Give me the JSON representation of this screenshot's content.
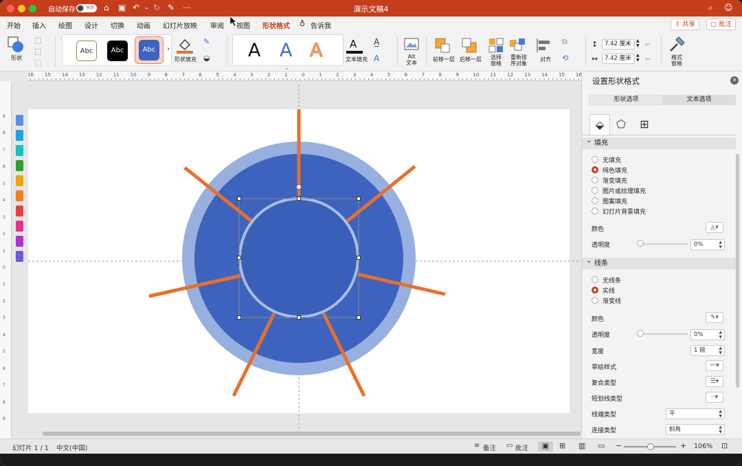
{
  "titlebar": {
    "autosave_label": "自动保存",
    "autosave_state": "关闭",
    "document_title": "演示文稿4"
  },
  "tabs": [
    "开始",
    "插入",
    "绘图",
    "设计",
    "切换",
    "动画",
    "幻灯片放映",
    "审阅",
    "视图",
    "形状格式",
    "告诉我"
  ],
  "active_tab": "形状格式",
  "share_label": "共享",
  "comments_label": "批注",
  "ribbon": {
    "shapes_label": "形状",
    "style_samples": [
      "Abc",
      "Abc",
      "Abc"
    ],
    "shape_fill_label": "形状填充",
    "wordart_samples": [
      "A",
      "A",
      "A"
    ],
    "text_fill_label": "文本填充",
    "alt_text_label": "Alt\n文本",
    "bring_forward_label": "前移一层",
    "send_backward_label": "后移一层",
    "selection_pane_label": "选择\n窗格",
    "reorder_label": "重新排\n序对象",
    "align_label": "对齐",
    "height_value": "7.42 厘米",
    "width_value": "7.42 厘米",
    "format_pane_label": "格式\n窗格"
  },
  "ruler_labels": [
    "16",
    "15",
    "14",
    "13",
    "12",
    "11",
    "10",
    "9",
    "8",
    "7",
    "6",
    "5",
    "4",
    "3",
    "2",
    "1",
    "0",
    "1",
    "2",
    "3",
    "4",
    "5",
    "6",
    "7",
    "8",
    "9",
    "10",
    "11",
    "12",
    "13",
    "14",
    "15",
    "16"
  ],
  "vruler_labels": [
    "9",
    "8",
    "7",
    "6",
    "5",
    "4",
    "3",
    "2",
    "1",
    "0",
    "1",
    "2",
    "3",
    "4",
    "5",
    "6",
    "7",
    "8",
    "9"
  ],
  "swatch_colors": [
    "#5b8def",
    "#1aa6e6",
    "#13c2c2",
    "#2ca02c",
    "#f0a500",
    "#f57c20",
    "#e84040",
    "#e8308a",
    "#b030d8",
    "#6a5ae0"
  ],
  "pane": {
    "title": "设置形状格式",
    "tab_shape_options": "形状选项",
    "tab_text_options": "文本选项",
    "fill_section": "填充",
    "fill_options": [
      "无填充",
      "纯色填充",
      "渐变填充",
      "图片或纹理填充",
      "图案填充",
      "幻灯片背景填充"
    ],
    "fill_selected": 1,
    "fill_color_label": "颜色",
    "fill_transparency_label": "透明度",
    "fill_transparency_value": "0%",
    "line_section": "线条",
    "line_options": [
      "无线条",
      "实线",
      "渐变线"
    ],
    "line_selected": 1,
    "line_color_label": "颜色",
    "line_transparency_label": "透明度",
    "line_transparency_value": "0%",
    "width_label": "宽度",
    "width_value": "1 磅",
    "sketch_label": "草绘样式",
    "compound_label": "复合类型",
    "dash_label": "短划线类型",
    "cap_label": "线端类型",
    "cap_value": "平",
    "join_label": "连接类型",
    "join_value": "斜角"
  },
  "status": {
    "slide_info": "幻灯片 1 / 1",
    "language": "中文(中国)",
    "notes_label": "备注",
    "comments_label": "批注",
    "zoom": "106%"
  },
  "colors": {
    "accent": "#c43e1c",
    "outer_circle": "#97b0e0",
    "main_circle": "#3d63be",
    "inner_ring": "#a9bde6",
    "inner_circle": "#3a5fb8",
    "rays": "#e8702a"
  }
}
